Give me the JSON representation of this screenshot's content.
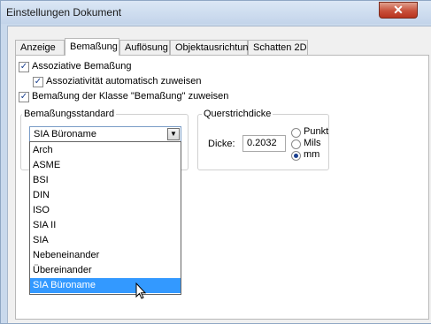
{
  "window": {
    "title": "Einstellungen Dokument",
    "close_glyph": "✕"
  },
  "tabs": [
    {
      "label": "Anzeige"
    },
    {
      "label": "Bemaßung"
    },
    {
      "label": "Auflösung"
    },
    {
      "label": "Objektausrichtung"
    },
    {
      "label": "Schatten 2D"
    }
  ],
  "active_tab": "Bemaßung",
  "options": {
    "associative": {
      "label": "Assoziative Bemaßung",
      "checked": true
    },
    "auto_assign": {
      "label": "Assoziativität automatisch zuweisen",
      "checked": true
    },
    "class_assign": {
      "label": "Bemaßung der Klasse \"Bemaßung\" zuweisen",
      "checked": true
    }
  },
  "standard_group": {
    "title": "Bemaßungsstandard",
    "selected": "SIA Büroname",
    "items": [
      "Arch",
      "ASME",
      "BSI",
      "DIN",
      "ISO",
      "SIA II",
      "SIA",
      "Nebeneinander",
      "Übereinander",
      "SIA Büroname"
    ],
    "highlighted_item": "SIA Büroname"
  },
  "thickness_group": {
    "title": "Querstrichdicke",
    "label": "Dicke:",
    "value": "0.2032",
    "units": [
      {
        "label": "Punkt",
        "selected": false
      },
      {
        "label": "Mils",
        "selected": false
      },
      {
        "label": "mm",
        "selected": true
      }
    ]
  },
  "colors": {
    "selection": "#3399ff",
    "check": "#1a3f8f"
  }
}
